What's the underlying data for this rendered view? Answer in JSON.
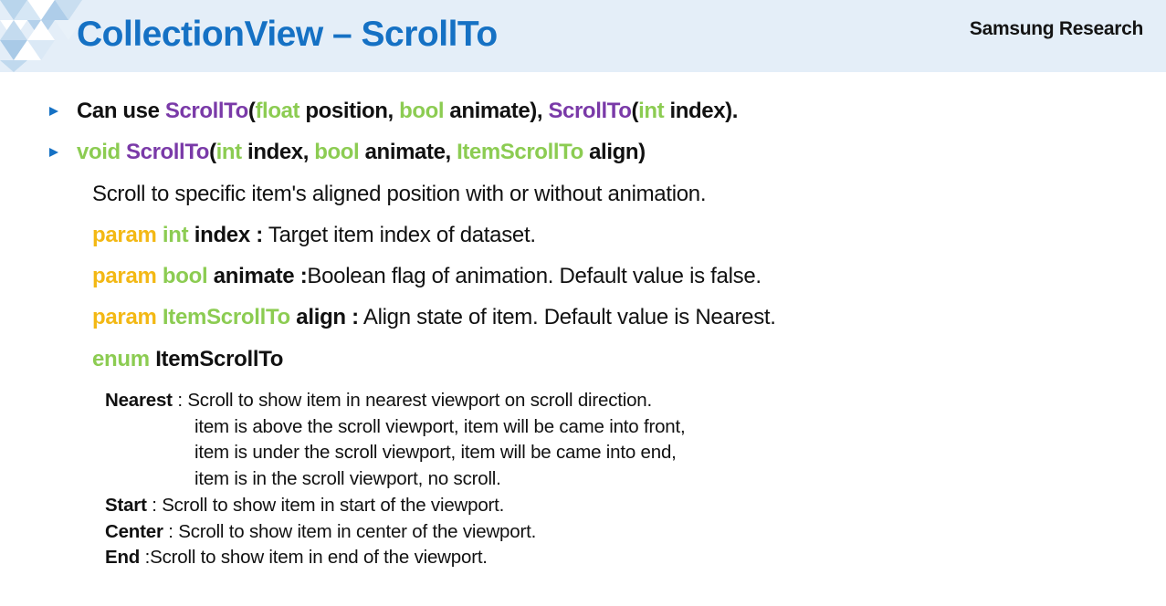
{
  "header": {
    "title": "CollectionView – ScrollTo",
    "brand": "Samsung Research"
  },
  "bullet1": {
    "p1": "Can use ",
    "m1": "ScrollTo",
    "p2": "(",
    "t1": "float",
    "p3": " position, ",
    "t2": "bool",
    "p4": " animate), ",
    "m2": "ScrollTo",
    "p5": "(",
    "t3": "int",
    "p6": " index)."
  },
  "bullet2": {
    "kw": "void",
    "p1": " ",
    "method": "ScrollTo",
    "p2": "(",
    "t1": "int",
    "p3": " index, ",
    "t2": "bool",
    "p4": " animate, ",
    "t3": "ItemScrollTo",
    "p5": " align)"
  },
  "description": "Scroll to specific item's aligned position with or without animation.",
  "params": [
    {
      "kw": "param",
      "type": "int",
      "name": "index :",
      "text": " Target item index of dataset."
    },
    {
      "kw": "param",
      "type": "bool",
      "name": "animate :",
      "text": "Boolean flag of animation. Default value is false."
    },
    {
      "kw": "param",
      "type": "ItemScrollTo",
      "name": "align :",
      "text": " Align state of item. Default value is Nearest."
    }
  ],
  "enum_decl": {
    "kw": "enum",
    "name": "ItemScrollTo"
  },
  "enum_values": {
    "nearest": {
      "name": "Nearest",
      "text": " : Scroll to show item in nearest viewport on scroll direction.",
      "continuation": [
        "item is above the scroll viewport, item will be came into front,",
        "item is under the scroll viewport, item will be came into end,",
        "item is in the scroll viewport, no scroll."
      ]
    },
    "start": {
      "name": "Start",
      "text": " : Scroll to show item in start of the viewport."
    },
    "center": {
      "name": "Center",
      "text": " : Scroll to show item in center of the viewport."
    },
    "end": {
      "name": "End",
      "text": " :Scroll to show item in end of the viewport."
    }
  },
  "colors": {
    "title_blue": "#1571c4",
    "method_purple": "#7a3aa8",
    "type_green": "#8ccc52",
    "param_yellow": "#f3b814",
    "header_bg": "#e4eef8"
  },
  "icons": [
    "triangle-bullet-icon",
    "header-triangle-pattern"
  ]
}
